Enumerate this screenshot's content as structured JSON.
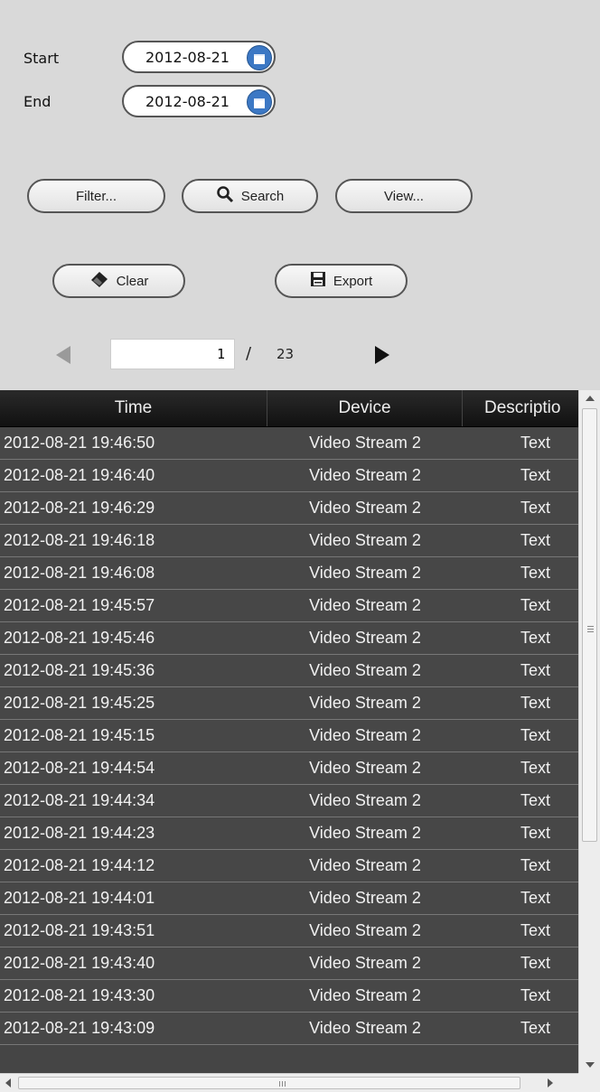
{
  "filters": {
    "start_label": "Start",
    "start_value": "2012-08-21",
    "end_label": "End",
    "end_value": "2012-08-21"
  },
  "actions": {
    "filter_label": "Filter...",
    "search_label": "Search",
    "view_label": "View...",
    "clear_label": "Clear",
    "export_label": "Export"
  },
  "pager": {
    "current_page": "1",
    "separator": "/",
    "total_pages": "23"
  },
  "table": {
    "columns": [
      "Time",
      "Device",
      "Descriptio"
    ],
    "rows": [
      [
        "2012-08-21 19:46:50",
        "Video Stream 2",
        "Text"
      ],
      [
        "2012-08-21 19:46:40",
        "Video Stream 2",
        "Text"
      ],
      [
        "2012-08-21 19:46:29",
        "Video Stream 2",
        "Text"
      ],
      [
        "2012-08-21 19:46:18",
        "Video Stream 2",
        "Text"
      ],
      [
        "2012-08-21 19:46:08",
        "Video Stream 2",
        "Text"
      ],
      [
        "2012-08-21 19:45:57",
        "Video Stream 2",
        "Text"
      ],
      [
        "2012-08-21 19:45:46",
        "Video Stream 2",
        "Text"
      ],
      [
        "2012-08-21 19:45:36",
        "Video Stream 2",
        "Text"
      ],
      [
        "2012-08-21 19:45:25",
        "Video Stream 2",
        "Text"
      ],
      [
        "2012-08-21 19:45:15",
        "Video Stream 2",
        "Text"
      ],
      [
        "2012-08-21 19:44:54",
        "Video Stream 2",
        "Text"
      ],
      [
        "2012-08-21 19:44:34",
        "Video Stream 2",
        "Text"
      ],
      [
        "2012-08-21 19:44:23",
        "Video Stream 2",
        "Text"
      ],
      [
        "2012-08-21 19:44:12",
        "Video Stream 2",
        "Text"
      ],
      [
        "2012-08-21 19:44:01",
        "Video Stream 2",
        "Text"
      ],
      [
        "2012-08-21 19:43:51",
        "Video Stream 2",
        "Text"
      ],
      [
        "2012-08-21 19:43:40",
        "Video Stream 2",
        "Text"
      ],
      [
        "2012-08-21 19:43:30",
        "Video Stream 2",
        "Text"
      ],
      [
        "2012-08-21 19:43:09",
        "Video Stream 2",
        "Text"
      ]
    ]
  },
  "icons": {
    "calendar": "calendar-icon",
    "search": "magnifier-icon",
    "clear": "eraser-icon",
    "export": "floppy-disk-icon"
  },
  "colors": {
    "panel_bg": "#d9d9d9",
    "grid_bg": "#474747",
    "header_bg": "#111111",
    "calendar_blue": "#3c78c4"
  }
}
